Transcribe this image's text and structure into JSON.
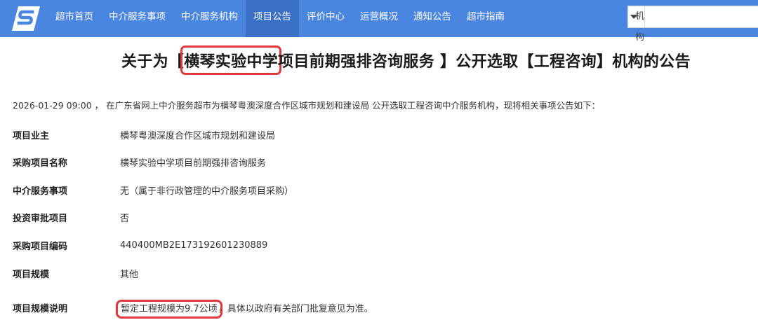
{
  "nav": {
    "items": [
      {
        "label": "超市首页",
        "active": false
      },
      {
        "label": "中介服务事项",
        "active": false
      },
      {
        "label": "中介服务机构",
        "active": false
      },
      {
        "label": "项目公告",
        "active": true
      },
      {
        "label": "评价中心",
        "active": false
      },
      {
        "label": "运营概况",
        "active": false
      },
      {
        "label": "通知公告",
        "active": false
      },
      {
        "label": "超市指南",
        "active": false
      }
    ]
  },
  "search": {
    "type_selected": "机构",
    "input_value": ""
  },
  "announcement": {
    "title_prefix": "关于为【",
    "title_highlight": "横琴实验中学",
    "title_rest": "项目前期强排咨询服务 】公开选取【工程咨询】机构的公告",
    "intro": "2026-01-29 09:00 ， 在广东省网上中介服务超市为横琴粤澳深度合作区城市规划和建设局 公开选取工程咨询中介服务机构，现将相关事项公告如下："
  },
  "details": {
    "rows": [
      {
        "label": "项目业主",
        "value": "横琴粤澳深度合作区城市规划和建设局"
      },
      {
        "label": "采购项目名称",
        "value": "横琴实验中学项目前期强排咨询服务"
      },
      {
        "label": "中介服务事项",
        "value": "无（属于非行政管理的中介服务项目采购）"
      },
      {
        "label": "投资审批项目",
        "value": "否"
      },
      {
        "label": "采购项目编码",
        "value": "440400MB2E173192601230889"
      },
      {
        "label": "项目规模",
        "value": "其他"
      }
    ],
    "scale_note_label": "项目规模说明",
    "scale_note_highlight": "暂定工程规模为9.7公顷",
    "scale_note_rest": "，具体以政府有关部门批复意见为准。"
  },
  "colors": {
    "header_bg": "#4a86e0",
    "nav_active_bg": "#3a6fc4",
    "highlight_box": "#e0383b"
  },
  "icons": {
    "logo": "s-logo-icon",
    "select_caret": "caret-down-icon"
  }
}
